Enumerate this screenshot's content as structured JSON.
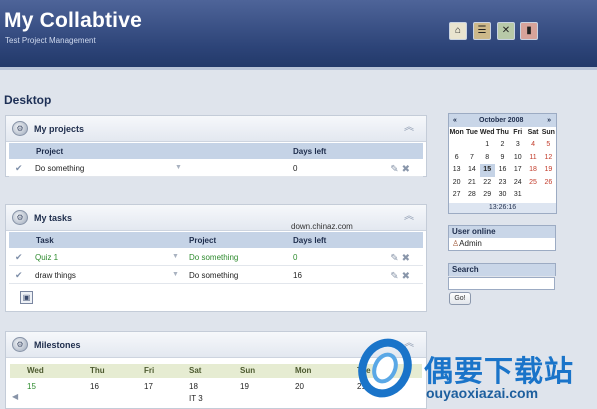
{
  "app": {
    "title": "My Collabtive",
    "subtitle": "Test Project Management"
  },
  "header_icons": [
    "home-icon",
    "settings-icon",
    "tools-icon",
    "logout-icon"
  ],
  "page_title": "Desktop",
  "projects": {
    "title": "My projects",
    "columns": [
      "Project",
      "Days left"
    ],
    "rows": [
      {
        "name": "Do something",
        "days_left": "0"
      }
    ]
  },
  "tasks": {
    "title": "My tasks",
    "columns": [
      "Task",
      "Project",
      "Days left"
    ],
    "rows": [
      {
        "task": "Quiz 1",
        "project": "Do something",
        "days_left": "0"
      },
      {
        "task": "draw things",
        "project": "Do something",
        "days_left": "16"
      }
    ]
  },
  "milestones": {
    "title": "Milestones",
    "days": [
      "Wed",
      "Thu",
      "Fri",
      "Sat",
      "Sun",
      "Mon",
      "Tue"
    ],
    "dates": [
      "15",
      "16",
      "17",
      "18",
      "19",
      "20",
      "21"
    ],
    "events": {
      "sat": "IT 3"
    }
  },
  "calendar": {
    "month": "October 2008",
    "prev": "«",
    "next": "»",
    "weekdays": [
      "Mon",
      "Tue",
      "Wed",
      "Thu",
      "Fri",
      "Sat",
      "Sun"
    ],
    "weeks": [
      [
        "",
        "",
        "1",
        "2",
        "3",
        "4",
        "5"
      ],
      [
        "6",
        "7",
        "8",
        "9",
        "10",
        "11",
        "12"
      ],
      [
        "13",
        "14",
        "15",
        "16",
        "17",
        "18",
        "19"
      ],
      [
        "20",
        "21",
        "22",
        "23",
        "24",
        "25",
        "26"
      ],
      [
        "27",
        "28",
        "29",
        "30",
        "31",
        "",
        ""
      ]
    ],
    "today": "15",
    "time": "13:26:16"
  },
  "user_online": {
    "title": "User online",
    "users": [
      "Admin"
    ]
  },
  "search": {
    "title": "Search",
    "value": "",
    "button": "Go!"
  },
  "watermark": {
    "url_text": "down.chinaz.com",
    "cn": "偶要下载站",
    "en": "ouyaoxiazai.com"
  },
  "colors": {
    "header": "#2d4478",
    "accent": "#1a74c9",
    "weekend": "#c23b2a",
    "link_green": "#2e8b2e"
  }
}
